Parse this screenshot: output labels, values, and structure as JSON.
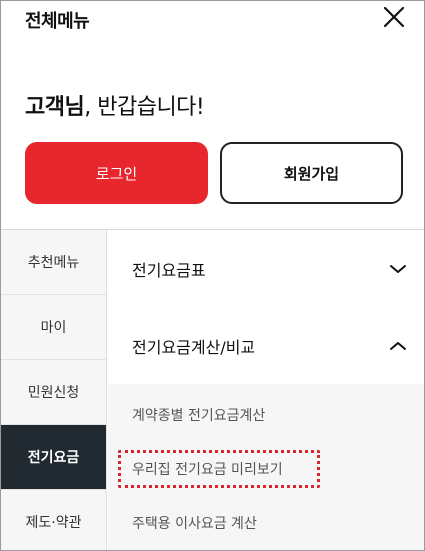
{
  "header": {
    "title": "전체메뉴",
    "close_icon": "close-icon"
  },
  "greeting": {
    "name": "고객님",
    "rest": ", 반갑습니다!"
  },
  "auth": {
    "login_label": "로그인",
    "signup_label": "회원가입",
    "login_color": "#e8262d"
  },
  "sidebar": {
    "items": [
      {
        "label": "추천메뉴",
        "active": false
      },
      {
        "label": "마이",
        "active": false
      },
      {
        "label": "민원신청",
        "active": false
      },
      {
        "label": "전기요금",
        "active": true
      },
      {
        "label": "제도·약관",
        "active": false
      }
    ],
    "active_color": "#222a31"
  },
  "content": {
    "categories": [
      {
        "label": "전기요금표",
        "icon": "chevron-down-icon",
        "expanded": false
      },
      {
        "label": "전기요금계산/비교",
        "icon": "chevron-up-icon",
        "expanded": true
      }
    ],
    "sub_items": [
      {
        "label": "계약종별 전기요금계산",
        "highlighted": false
      },
      {
        "label": "우리집 전기요금 미리보기",
        "highlighted": true
      },
      {
        "label": "주택용 이사요금 계산",
        "highlighted": false
      }
    ],
    "highlight_color": "#d7262e"
  }
}
